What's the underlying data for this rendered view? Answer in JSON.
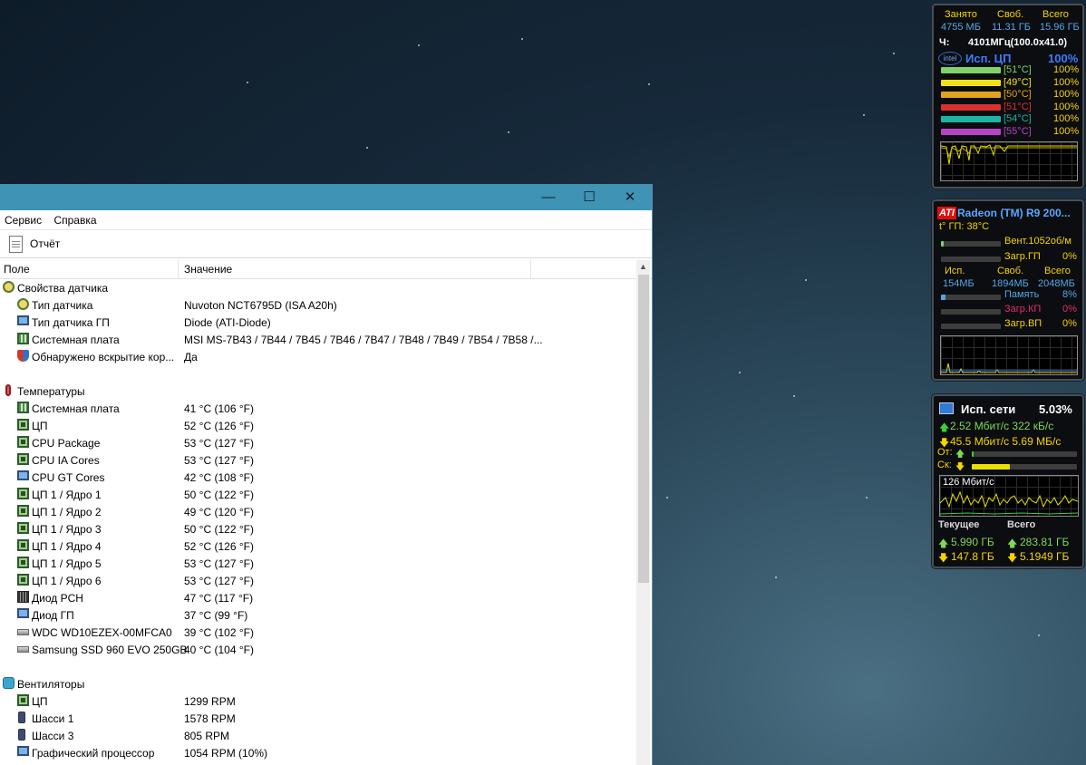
{
  "window": {
    "menu": [
      "Сервис",
      "Справка"
    ],
    "toolbar_report": "Отчёт",
    "col_field": "Поле",
    "col_value": "Значение",
    "rows": [
      {
        "type": "group",
        "icon": "gauge-icon",
        "label": "Свойства датчика"
      },
      {
        "type": "item",
        "icon": "gauge-icon",
        "label": "Тип датчика",
        "value": "Nuvoton NCT6795D  (ISA A20h)"
      },
      {
        "type": "item",
        "icon": "monitor-icon",
        "label": "Тип датчика ГП",
        "value": "Diode  (ATI-Diode)"
      },
      {
        "type": "item",
        "icon": "motherboard-icon",
        "label": "Системная плата",
        "value": "MSI MS-7B43 / 7B44 / 7B45 / 7B46 / 7B47 / 7B48 / 7B49 / 7B54 / 7B58 /..."
      },
      {
        "type": "item",
        "icon": "shield-icon",
        "label": "Обнаружено вскрытие кор...",
        "value": "Да"
      },
      {
        "type": "blank"
      },
      {
        "type": "group",
        "icon": "thermometer-icon",
        "label": "Температуры"
      },
      {
        "type": "item",
        "icon": "motherboard-icon",
        "label": "Системная плата",
        "value": "41 °C  (106 °F)"
      },
      {
        "type": "item",
        "icon": "chip-icon",
        "label": "ЦП",
        "value": "52 °C  (126 °F)"
      },
      {
        "type": "item",
        "icon": "chip-icon",
        "label": "CPU Package",
        "value": "53 °C  (127 °F)"
      },
      {
        "type": "item",
        "icon": "chip-icon",
        "label": "CPU IA Cores",
        "value": "53 °C  (127 °F)"
      },
      {
        "type": "item",
        "icon": "monitor-icon",
        "label": "CPU GT Cores",
        "value": "42 °C  (108 °F)"
      },
      {
        "type": "item",
        "icon": "chip-icon",
        "label": "ЦП 1 / Ядро 1",
        "value": "50 °C  (122 °F)"
      },
      {
        "type": "item",
        "icon": "chip-icon",
        "label": "ЦП 1 / Ядро 2",
        "value": "49 °C  (120 °F)"
      },
      {
        "type": "item",
        "icon": "chip-icon",
        "label": "ЦП 1 / Ядро 3",
        "value": "50 °C  (122 °F)"
      },
      {
        "type": "item",
        "icon": "chip-icon",
        "label": "ЦП 1 / Ядро 4",
        "value": "52 °C  (126 °F)"
      },
      {
        "type": "item",
        "icon": "chip-icon",
        "label": "ЦП 1 / Ядро 5",
        "value": "53 °C  (127 °F)"
      },
      {
        "type": "item",
        "icon": "chip-icon",
        "label": "ЦП 1 / Ядро 6",
        "value": "53 °C  (127 °F)"
      },
      {
        "type": "item",
        "icon": "pch-icon",
        "label": "Диод PCH",
        "value": "47 °C  (117 °F)"
      },
      {
        "type": "item",
        "icon": "monitor-icon",
        "label": "Диод ГП",
        "value": "37 °C  (99 °F)"
      },
      {
        "type": "item",
        "icon": "disk-icon",
        "label": "WDC WD10EZEX-00MFCA0",
        "value": "39 °C  (102 °F)"
      },
      {
        "type": "item",
        "icon": "disk-icon",
        "label": "Samsung SSD 960 EVO 250GB",
        "value": "40 °C  (104 °F)"
      },
      {
        "type": "blank"
      },
      {
        "type": "group",
        "icon": "fan-icon",
        "label": "Вентиляторы"
      },
      {
        "type": "item",
        "icon": "chip-icon",
        "label": "ЦП",
        "value": "1299 RPM"
      },
      {
        "type": "item",
        "icon": "phone-icon",
        "label": "Шасси 1",
        "value": "1578 RPM"
      },
      {
        "type": "item",
        "icon": "phone-icon",
        "label": "Шасси 3",
        "value": "805 RPM"
      },
      {
        "type": "item",
        "icon": "monitor-icon",
        "label": "Графический процессор",
        "value": "1054 RPM  (10%)"
      }
    ]
  },
  "cpu_gadget": {
    "h_busy": "Занято",
    "h_free": "Своб.",
    "h_total": "Всего",
    "v_busy": "4755 МБ",
    "v_free": "11.31 ГБ",
    "v_total": "15.96 ГБ",
    "freq_label": "Ч:",
    "freq_value": "4101МГц(100.0x41.0)",
    "cpu_usage_label": "Исп. ЦП",
    "cpu_usage_value": "100%",
    "cores": [
      {
        "temp": "[51°C]",
        "pct": "100%",
        "color": "#7fd36b",
        "textcolor": "#7fd36b"
      },
      {
        "temp": "[49°C]",
        "pct": "100%",
        "color": "#f2e21c",
        "textcolor": "#f2e21c"
      },
      {
        "temp": "[50°C]",
        "pct": "100%",
        "color": "#e0a31c",
        "textcolor": "#e0a31c"
      },
      {
        "temp": "[51°C]",
        "pct": "100%",
        "color": "#d93030",
        "textcolor": "#d93030"
      },
      {
        "temp": "[54°C]",
        "pct": "100%",
        "color": "#1fb3a6",
        "textcolor": "#1fb3a6"
      },
      {
        "temp": "[55°C]",
        "pct": "100%",
        "color": "#b545c4",
        "textcolor": "#b545c4"
      }
    ]
  },
  "gpu_gadget": {
    "logo": "ATI",
    "name": "Radeon (TM) R9 200...",
    "temp": "t° ГП: 38°C",
    "fan": "Вент.1052об/м",
    "load_label": "Загр.ГП",
    "load_value": "0%",
    "h_used": "Исп.",
    "h_free": "Своб.",
    "h_total": "Всего",
    "v_used": "154МБ",
    "v_free": "1894МБ",
    "v_total": "2048МБ",
    "mem_label": "Память",
    "mem_value": "8%",
    "kp_label": "Загр.КП",
    "kp_value": "0%",
    "vp_label": "Загр.ВП",
    "vp_value": "0%",
    "fan_level": 0.05,
    "mem_level": 0.08
  },
  "net_gadget": {
    "title": "Исп. сети",
    "title_value": "5.03%",
    "up": "2.52 Мбит/с 322 кБ/с",
    "down": "45.5 Мбит/с 5.69 МБ/с",
    "ot_label": "От:",
    "sk_label": "Ск:",
    "graph_label": "126 Мбит/с",
    "cur_label": "Текущее",
    "total_label": "Всего",
    "cur_up": "5.990 ГБ",
    "cur_down": "147.8 ГБ",
    "tot_up": "283.81 ГБ",
    "tot_down": "5.1949 ГБ",
    "ot_level": 0.02,
    "sk_level": 0.36
  }
}
